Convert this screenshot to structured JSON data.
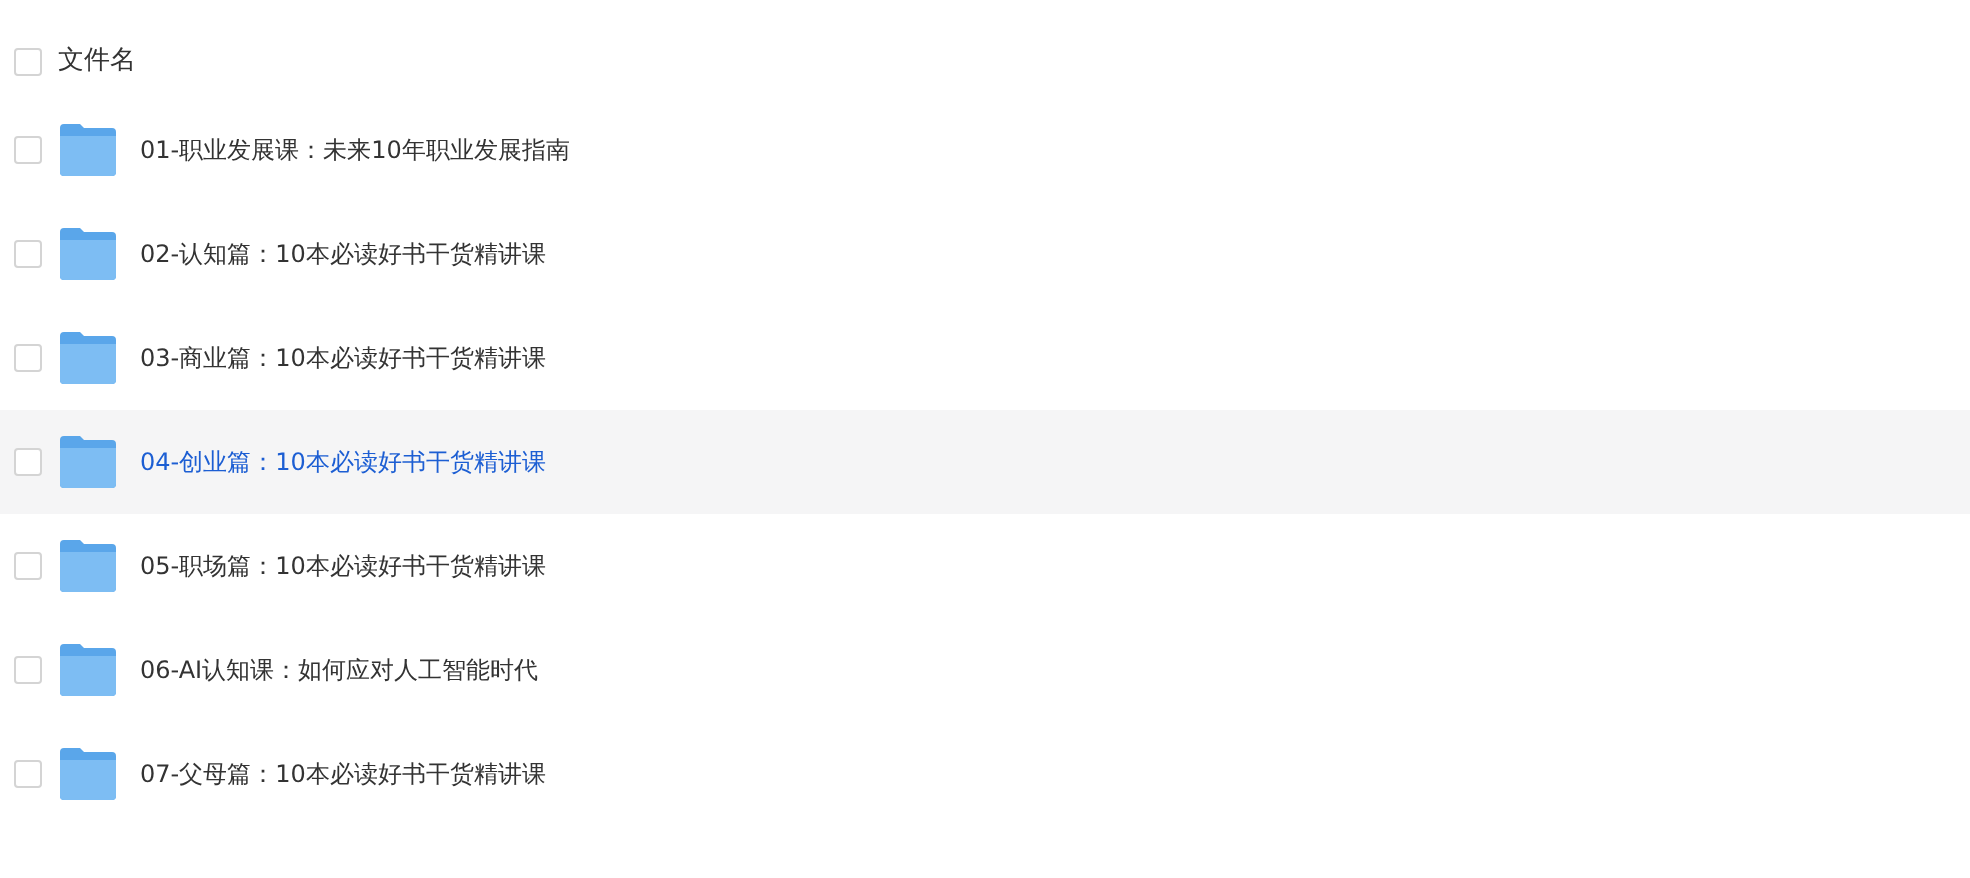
{
  "header": {
    "label": "文件名",
    "checked": false
  },
  "files": [
    {
      "name": "01-职业发展课：未来10年职业发展指南",
      "checked": false,
      "highlighted": false
    },
    {
      "name": "02-认知篇：10本必读好书干货精讲课",
      "checked": false,
      "highlighted": false
    },
    {
      "name": "03-商业篇：10本必读好书干货精讲课",
      "checked": false,
      "highlighted": false
    },
    {
      "name": "04-创业篇：10本必读好书干货精讲课",
      "checked": false,
      "highlighted": true
    },
    {
      "name": "05-职场篇：10本必读好书干货精讲课",
      "checked": false,
      "highlighted": false
    },
    {
      "name": "06-AI认知课：如何应对人工智能时代",
      "checked": false,
      "highlighted": false
    },
    {
      "name": "07-父母篇：10本必读好书干货精讲课",
      "checked": false,
      "highlighted": false
    }
  ]
}
